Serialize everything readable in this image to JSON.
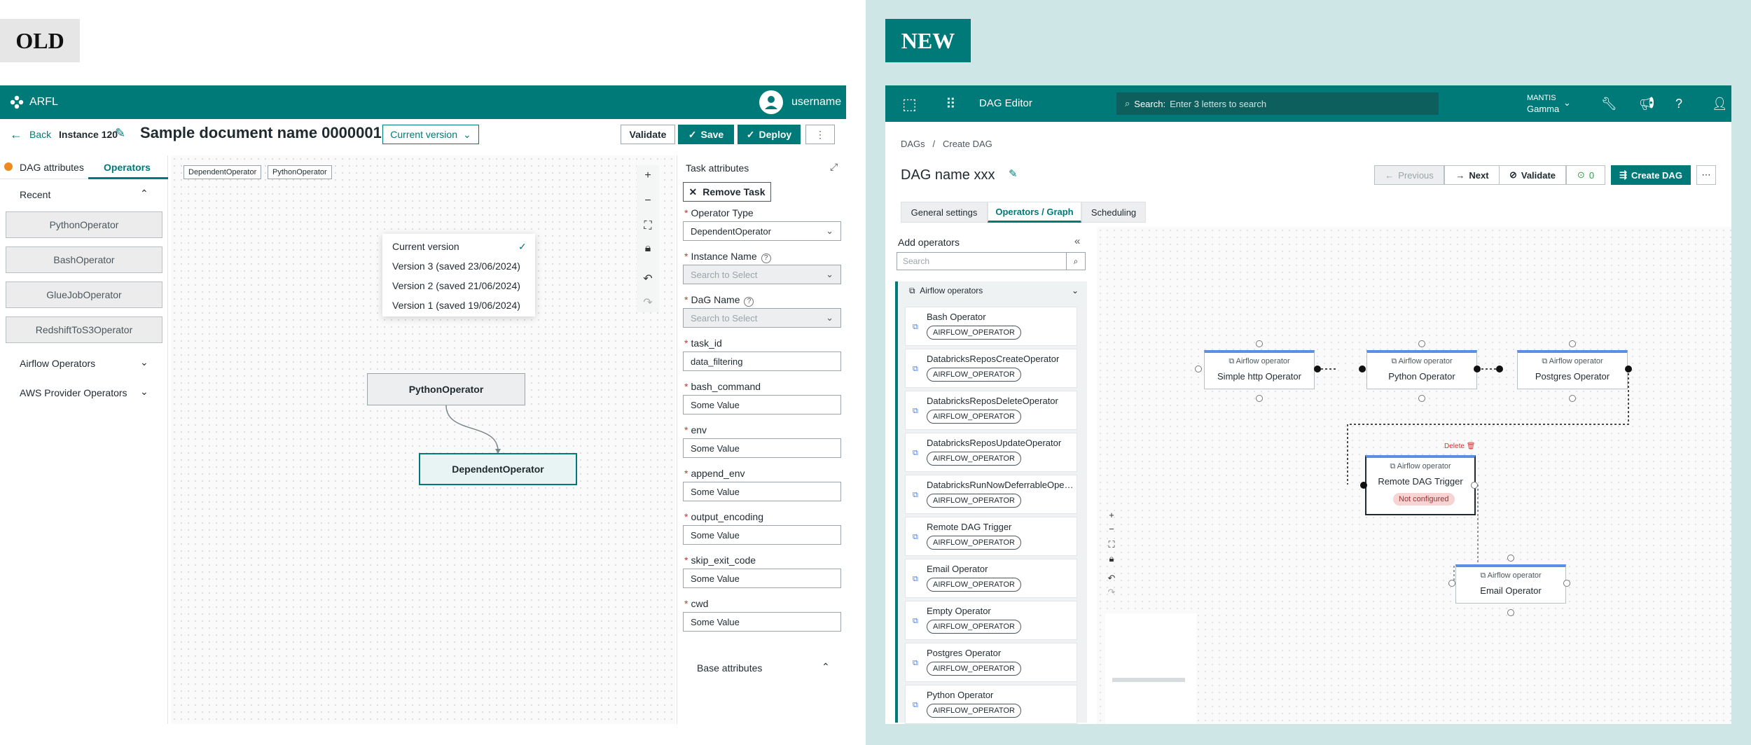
{
  "labels": {
    "old": "OLD",
    "new": "NEW"
  },
  "colors": {
    "brand": "#007a78",
    "new_bg": "#cfe6e6",
    "warning": "#ef8a1e",
    "danger": "#d62f2f",
    "node_accent": "#5b8fe6"
  },
  "old": {
    "header": {
      "brand": "ARFL",
      "username": "username"
    },
    "toolbar": {
      "back": "Back",
      "instance": "Instance 120",
      "doc_title": "Sample document name 0000001",
      "version": "Current version",
      "validate": "Validate",
      "save": "Save",
      "deploy": "Deploy"
    },
    "version_menu": [
      "Current version",
      "Version 3 (saved 23/06/2024)",
      "Version 2 (saved 21/06/2024)",
      "Version 1 (saved 19/06/2024)"
    ],
    "sidebar": {
      "tabs": [
        "DAG attributes",
        "Operators"
      ],
      "recent": "Recent",
      "recent_items": [
        "PythonOperator",
        "BashOperator",
        "GlueJobOperator",
        "RedshiftToS3Operator"
      ],
      "groups": [
        "Airflow Operators",
        "AWS Provider Operators"
      ]
    },
    "canvas": {
      "chips": [
        "DependentOperator",
        "PythonOperator"
      ],
      "nodes": [
        "PythonOperator",
        "DependentOperator"
      ]
    },
    "task": {
      "title": "Task attributes",
      "remove": "Remove Task",
      "fields": [
        {
          "label": "Operator Type",
          "value": "DependentOperator"
        },
        {
          "label": "Instance Name",
          "value": "Search to Select"
        },
        {
          "label": "DaG Name",
          "value": "Search to Select"
        },
        {
          "label": "task_id",
          "value": "data_filtering"
        },
        {
          "label": "bash_command",
          "value": "Some Value"
        },
        {
          "label": "env",
          "value": "Some Value"
        },
        {
          "label": "append_env",
          "value": "Some Value"
        },
        {
          "label": "output_encoding",
          "value": "Some Value"
        },
        {
          "label": "skip_exit_code",
          "value": "Some Value"
        },
        {
          "label": "cwd",
          "value": "Some Value"
        }
      ],
      "base_attributes": "Base attributes"
    }
  },
  "new": {
    "header": {
      "title": "DAG Editor",
      "search_prefix": "Search:",
      "search_placeholder": "Enter 3 letters to search",
      "org_top": "MANTIS",
      "org_bottom": "Gamma"
    },
    "breadcrumb": {
      "root": "DAGs",
      "sep": "/",
      "current": "Create DAG"
    },
    "page_title": "DAG name xxx",
    "actions": {
      "previous": "Previous",
      "next": "Next",
      "validate": "Validate",
      "count": "0",
      "create": "Create DAG"
    },
    "tabs": [
      "General settings",
      "Operators / Graph",
      "Scheduling"
    ],
    "sidebar": {
      "title": "Add operators",
      "search_placeholder": "Search",
      "group": "Airflow operators",
      "operators": [
        {
          "name": "Bash Operator",
          "badge": "AIRFLOW_OPERATOR"
        },
        {
          "name": "DatabricksReposCreateOperator",
          "badge": "AIRFLOW_OPERATOR"
        },
        {
          "name": "DatabricksReposDeleteOperator",
          "badge": "AIRFLOW_OPERATOR"
        },
        {
          "name": "DatabricksReposUpdateOperator",
          "badge": "AIRFLOW_OPERATOR"
        },
        {
          "name": "DatabricksRunNowDeferrableOperator",
          "badge": "AIRFLOW_OPERATOR"
        },
        {
          "name": "Remote DAG Trigger",
          "badge": "AIRFLOW_OPERATOR"
        },
        {
          "name": "Email Operator",
          "badge": "AIRFLOW_OPERATOR"
        },
        {
          "name": "Empty Operator",
          "badge": "AIRFLOW_OPERATOR"
        },
        {
          "name": "Postgres Operator",
          "badge": "AIRFLOW_OPERATOR"
        },
        {
          "name": "Python Operator",
          "badge": "AIRFLOW_OPERATOR"
        }
      ]
    },
    "graph": {
      "node_type": "Airflow operator",
      "nodes": [
        "Simple http Operator",
        "Python Operator",
        "Postgres Operator",
        "Remote DAG Trigger",
        "Email Operator"
      ],
      "not_configured": "Not configured",
      "delete": "Delete"
    }
  }
}
